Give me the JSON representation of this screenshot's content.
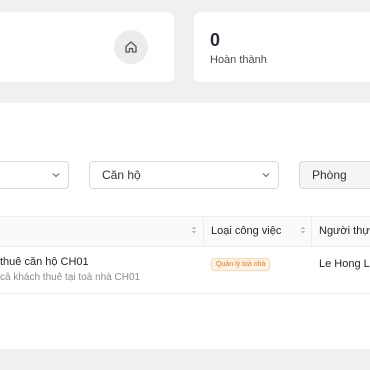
{
  "stats": {
    "completed_value": "0",
    "completed_label": "Hoàn thành"
  },
  "filters": {
    "first_value": "",
    "apartment_placeholder": "Căn hộ",
    "room_placeholder": "Phòng"
  },
  "table": {
    "columns": [
      "",
      "Loại công việc",
      "Người thực hiện"
    ],
    "rows": [
      {
        "title": "thuê căn hộ CH01",
        "subtitle": "cả khách thuê tại toà nhà CH01",
        "task_type": "Quản lý toà nhà",
        "assignee": "Le Hong Li"
      }
    ]
  },
  "colors": {
    "tag_text": "#f5731f",
    "tag_bg": "#fff3e6"
  },
  "icons": [
    "home-icon",
    "chevron-down-icon",
    "sort-icon"
  ]
}
